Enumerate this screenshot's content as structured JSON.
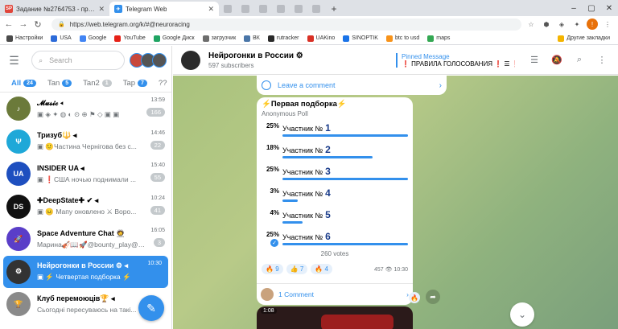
{
  "browser": {
    "tabs": [
      {
        "title": "Задание №2764753 - просмотр з",
        "favicon_text": "SP",
        "color": "#e0453a"
      },
      {
        "title": "Telegram Web",
        "favicon_text": "✈",
        "color": "#3390ec"
      }
    ],
    "url": "https://web.telegram.org/k/#@neuroracing",
    "bookmarks": [
      {
        "label": "Настройки",
        "color": "#4a4a4a"
      },
      {
        "label": "USA",
        "color": "#2c6bd9"
      },
      {
        "label": "Google",
        "color": "#4285f4"
      },
      {
        "label": "YouTube",
        "color": "#e62117"
      },
      {
        "label": "Google Диск",
        "color": "#1fa463"
      },
      {
        "label": "загрузчик",
        "color": "#6d6d6d"
      },
      {
        "label": "ВК",
        "color": "#4a76a8"
      },
      {
        "label": "rutracker",
        "color": "#2a2a2a"
      },
      {
        "label": "UAKino",
        "color": "#d93025"
      },
      {
        "label": "SINOPTIK",
        "color": "#1a73e8"
      },
      {
        "label": "btc to usd",
        "color": "#f7931a"
      },
      {
        "label": "maps",
        "color": "#34a853"
      }
    ],
    "other_bookmarks": "Другие закладки"
  },
  "sidebar": {
    "search_placeholder": "Search",
    "filter_tabs": [
      {
        "label": "All",
        "count": "24"
      },
      {
        "label": "Tan",
        "count": "5"
      },
      {
        "label": "Tan2",
        "count": "1"
      },
      {
        "label": "Tap",
        "count": "7"
      },
      {
        "label": "??",
        "count": ""
      }
    ],
    "chats": [
      {
        "name": "𝓜𝓾𝓼𝓲𝓬 ◂",
        "preview": "▣ ◈ ✦ ◍ ◐ ⊙ ⊕ ⚑ ◇ ▣ ▣",
        "time": "13:59",
        "count": "166",
        "avatar_color": "#6b7a3a"
      },
      {
        "name": "Тризуб🔱 ◂",
        "preview": "▣ 🙂Частина Чернігова без с...",
        "time": "14:46",
        "count": "22",
        "avatar_color": "#1fa8d8"
      },
      {
        "name": "INSIDER UA ◂",
        "preview": "▣ ❗️США ночью поднимали ...",
        "time": "15:40",
        "count": "55",
        "avatar_color": "#1e4fbf"
      },
      {
        "name": "✚DeepState✚ ✔ ◂",
        "preview": "▣ 😐 Мапу оновлено ⚔ Воро...",
        "time": "10:24",
        "count": "41",
        "avatar_color": "#111111"
      },
      {
        "name": "Space Adventure Chat 🧑‍🚀",
        "preview": "Марина🎻📖🚀@bounty_play@m...",
        "time": "16:05",
        "count": "3",
        "avatar_color": "#5a3ec8"
      },
      {
        "name": "Нейрогонки в России ⚙ ◂",
        "preview": "▣ ⚡ Четвертая подборка ⚡",
        "time": "10:30",
        "count": "",
        "avatar_color": "#333333"
      },
      {
        "name": "Клуб перемоюців🏆 ◂",
        "preview": "Сьогодні пересуваюсь на такі...",
        "time": "",
        "count": "",
        "avatar_color": "#8a8a8a"
      }
    ]
  },
  "chat_header": {
    "title": "Нейрогонки в России ⚙",
    "subtitle": "597 subscribers",
    "pinned_label": "Pinned Message",
    "pinned_text": "❗ ПРАВИЛА ГОЛОСОВАНИЯ ❗ ☰ ❗"
  },
  "messages": {
    "prev_comment": "Leave a comment",
    "poll": {
      "question": "⚡Первая подборка⚡",
      "type": "Anonymous Poll",
      "options": [
        {
          "percent": "25%",
          "text": "Участник №",
          "num": "1",
          "value": 25,
          "chosen": false
        },
        {
          "percent": "18%",
          "text": "Участник №",
          "num": "2",
          "value": 18,
          "chosen": false
        },
        {
          "percent": "25%",
          "text": "Участник №",
          "num": "3",
          "value": 25,
          "chosen": false
        },
        {
          "percent": "3%",
          "text": "Участник №",
          "num": "4",
          "value": 3,
          "chosen": false
        },
        {
          "percent": "4%",
          "text": "Участник №",
          "num": "5",
          "value": 4,
          "chosen": false
        },
        {
          "percent": "25%",
          "text": "Участник №",
          "num": "6",
          "value": 25,
          "chosen": true
        }
      ],
      "votes": "260 votes",
      "reactions": [
        {
          "emoji": "🔥",
          "count": "9"
        },
        {
          "emoji": "👍",
          "count": "7"
        },
        {
          "emoji": "🔥",
          "count": "4"
        }
      ],
      "views": "457 👁 10:30",
      "comments": "1 Comment"
    },
    "media_duration": "1:08"
  }
}
